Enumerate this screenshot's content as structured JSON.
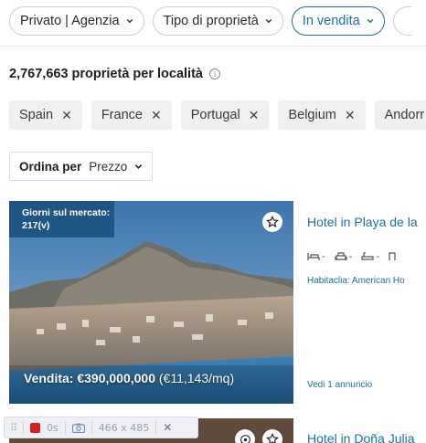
{
  "filters": [
    {
      "label": "Privato | Agenzia",
      "active": false
    },
    {
      "label": "Tipo di proprietà",
      "active": false
    },
    {
      "label": "In vendita",
      "active": true
    }
  ],
  "results": {
    "count_label": "2,767,663 proprietà per località",
    "info_icon": "info-icon"
  },
  "countries": [
    "Spain",
    "France",
    "Portugal",
    "Belgium",
    "Andorr"
  ],
  "sort": {
    "label": "Ordina per",
    "value": "Prezzo"
  },
  "listings": [
    {
      "days_on_market": "Giorni sul mercato: 217(v)",
      "price_label": "Vendita: €390,000,000",
      "price_per_sqm": "(€11,143/mq)",
      "title": "Hotel in Playa de la",
      "features": [
        "-",
        "-",
        "-"
      ],
      "agency": "Habitaclia: American Ho",
      "see_ad": "Vedi 1 annuncio"
    },
    {
      "title": "Hotel in Doña Julia"
    }
  ],
  "recorder": {
    "time": "0s",
    "size": "466 x 485"
  },
  "colors": {
    "accent": "#1b6fa8",
    "badge": "#1c5380",
    "record": "#d81f1f"
  }
}
